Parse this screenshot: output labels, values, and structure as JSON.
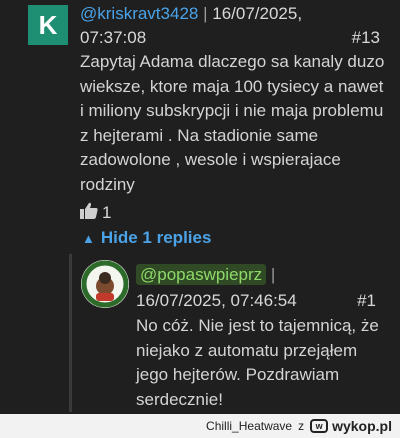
{
  "comment": {
    "avatar_letter": "K",
    "username": "@kriskravt3428",
    "separator": "|",
    "date": "16/07/2025,",
    "time": "07:37:08",
    "number": "#13",
    "body": "Zapytaj Adama dlaczego sa kanaly duzo wieksze, ktore maja 100 tysiecy a nawet i miliony subskrypcji i nie maja problemu z hejterami . Na stadionie same zadowolone , wesole i wspierajace rodziny",
    "likes": "1",
    "replies_label": "Hide 1 replies",
    "accent_color": "#4aa3e8"
  },
  "reply": {
    "username": "@popaswpieprz",
    "separator": "|",
    "datetime": "16/07/2025, 07:46:54",
    "number": "#1",
    "body": "No cóż. Nie jest to tajemnicą, że niejako z automatu przejąłem jego hejterów. Pozdrawiam serdecznie!"
  },
  "footer": {
    "author": "Chilli_Heatwave",
    "z": "z",
    "site": "wykop.pl"
  }
}
